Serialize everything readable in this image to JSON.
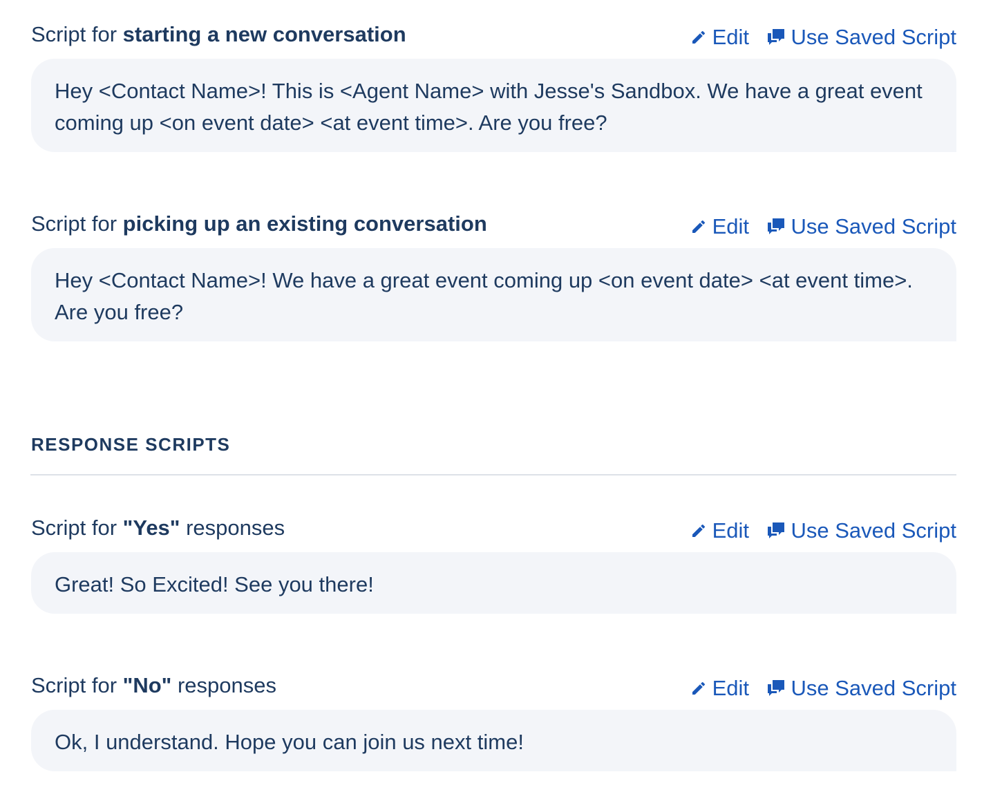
{
  "colors": {
    "link": "#1a58b9",
    "text": "#1e3a5f",
    "box_bg": "#f3f5f9",
    "highlight_underline": "#e0202a"
  },
  "actions": {
    "edit_label": "Edit",
    "edit_icon": "pencil-icon",
    "saved_label": "Use Saved Script",
    "saved_icon": "chat-bubbles-icon"
  },
  "initial_scripts": [
    {
      "prefix": "Script for ",
      "bold": "starting a new conversation",
      "suffix": "",
      "text": "Hey <Contact Name>! This is <Agent Name> with Jesse's Sandbox. We have a great event coming up <on event date> <at event time>. Are you free?"
    },
    {
      "prefix": "Script for ",
      "bold": "picking up an existing conversation",
      "suffix": "",
      "text": "Hey <Contact Name>! We have a great event coming up <on event date> <at event time>. Are you free?"
    }
  ],
  "response_section": {
    "heading": "RESPONSE SCRIPTS"
  },
  "response_scripts": [
    {
      "prefix": "Script for ",
      "bold": "\"Yes\"",
      "suffix": " responses",
      "text": "Great! So Excited! See you there!"
    },
    {
      "prefix": "Script for ",
      "bold": "\"No\"",
      "suffix": " responses",
      "text": "Ok, I understand. Hope you can join us next time!"
    }
  ]
}
